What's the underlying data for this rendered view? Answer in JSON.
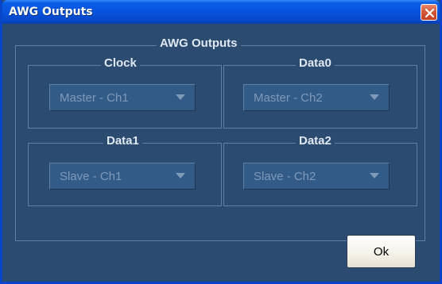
{
  "window": {
    "title": "AWG Outputs",
    "close_icon": "close-icon"
  },
  "group": {
    "title": "AWG Outputs",
    "outputs": [
      {
        "label": "Clock",
        "value": "Master - Ch1"
      },
      {
        "label": "Data0",
        "value": "Master - Ch2"
      },
      {
        "label": "Data1",
        "value": "Slave - Ch1"
      },
      {
        "label": "Data2",
        "value": "Slave - Ch2"
      }
    ]
  },
  "buttons": {
    "ok_label": "Ok"
  },
  "colors": {
    "titlebar": "#0752dc",
    "client_background": "#2c4b70",
    "disabled_text": "#7f99b9",
    "close_button": "#d4573a"
  }
}
